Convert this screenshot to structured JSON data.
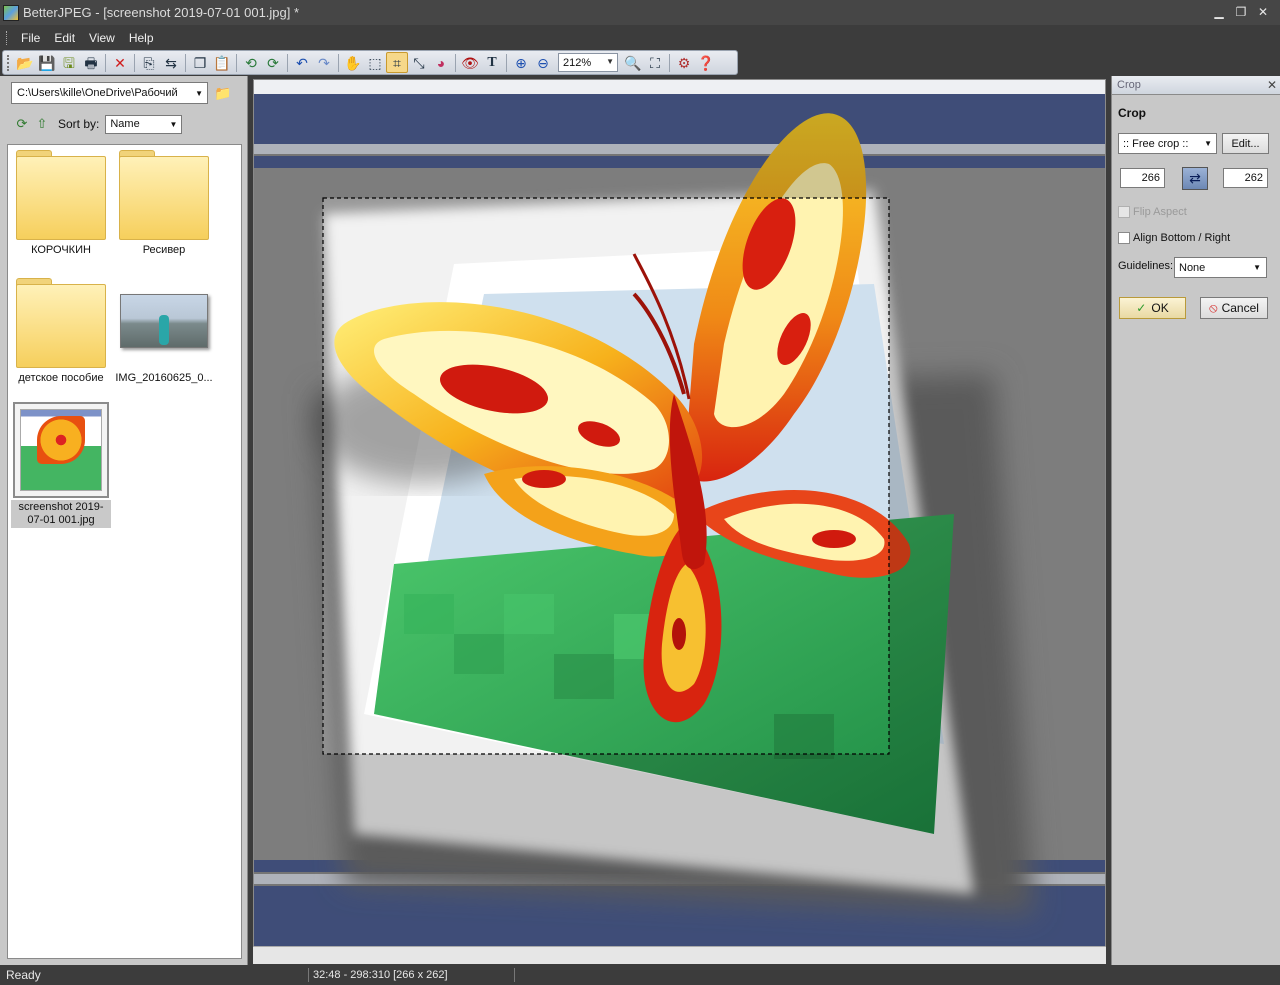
{
  "window": {
    "app_name": "BetterJPEG",
    "title": "BetterJPEG - [screenshot 2019-07-01 001.jpg] *",
    "minimize": "▁",
    "restore": "❐",
    "close": "✕"
  },
  "menu": [
    "File",
    "Edit",
    "View",
    "Help"
  ],
  "toolbar": {
    "zoom_value": "212%",
    "icons": [
      "open-icon",
      "save-icon",
      "save-as-icon",
      "print-icon",
      "delete-icon",
      "copy-file-icon",
      "move-file-icon",
      "copy-icon",
      "paste-icon",
      "rotate-left-icon",
      "rotate-right-icon",
      "undo-icon",
      "redo-icon",
      "hand-icon",
      "select-rect-icon",
      "crop-icon",
      "resize-icon",
      "color-icon",
      "redeye-icon",
      "text-icon",
      "zoom-in-icon",
      "zoom-out-icon",
      "zoom-fit-icon",
      "zoom-actual-icon",
      "settings-icon",
      "help-icon"
    ]
  },
  "browser": {
    "path": "C:\\Users\\kille\\OneDrive\\Рабочий",
    "sort_label": "Sort by:",
    "sort_value": "Name",
    "items": [
      {
        "label": "КОРОЧКИН",
        "type": "folder"
      },
      {
        "label": "Ресивер",
        "type": "folder"
      },
      {
        "label": "детское пособие",
        "type": "folder"
      },
      {
        "label": "IMG_20160625_0...",
        "type": "photo"
      },
      {
        "label": "screenshot 2019-07-01 001.jpg",
        "type": "image",
        "selected": true
      }
    ]
  },
  "crop_panel": {
    "header": "Crop",
    "title": "Crop",
    "mode": ":: Free crop ::",
    "edit_label": "Edit...",
    "width": "266",
    "height": "262",
    "flip_aspect": "Flip Aspect",
    "align_bottom_right": "Align Bottom / Right",
    "guidelines_label": "Guidelines:",
    "guidelines_value": "None",
    "ok_label": "OK",
    "cancel_label": "Cancel"
  },
  "status": {
    "state": "Ready",
    "selection": "32:48 - 298:310  [266 x 262]"
  },
  "colors": {
    "chrome_dark": "#3c3c3c",
    "panel_gray": "#c8c8c8",
    "stripe_blue": "#4d5f93",
    "accent_highlight": "#f6d88a"
  }
}
